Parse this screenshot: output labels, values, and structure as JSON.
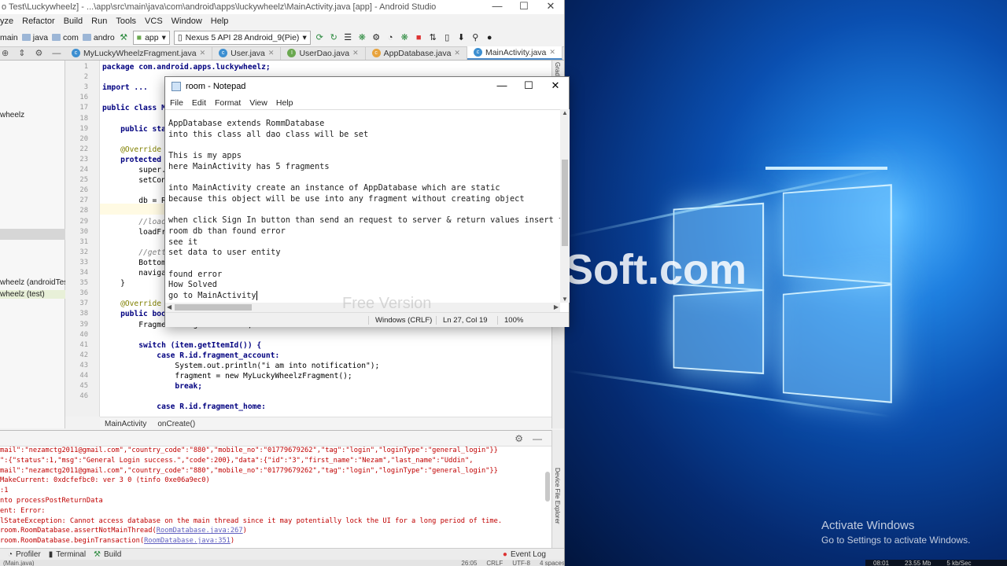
{
  "android_studio": {
    "title": "o Test\\Luckywheelz] - ...\\app\\src\\main\\java\\com\\android\\apps\\luckywheelz\\MainActivity.java [app] - Android Studio",
    "menu": [
      "yze",
      "Refactor",
      "Build",
      "Run",
      "Tools",
      "VCS",
      "Window",
      "Help"
    ],
    "breadcrumbs": [
      "main",
      "java",
      "com",
      "andro"
    ],
    "run_config": "app",
    "device": "Nexus 5 API 28 Android_9(Pie)",
    "tabs": [
      {
        "label": "MyLuckyWheelzFragment.java",
        "icon": "class-icon"
      },
      {
        "label": "User.java",
        "icon": "class-icon"
      },
      {
        "label": "UserDao.java",
        "icon": "interface-icon"
      },
      {
        "label": "AppDatabase.java",
        "icon": "abstract-class-icon"
      },
      {
        "label": "MainActivity.java",
        "icon": "class-icon",
        "active": true
      }
    ],
    "project_items": [
      "wheelz",
      "wheelz (androidTest)",
      "wheelz (test)"
    ],
    "line_numbers": [
      "1",
      "2",
      "3",
      "16",
      "17",
      "18",
      "19",
      "20",
      "22",
      "23",
      "24",
      "25",
      "26",
      "27",
      "28",
      "29",
      "30",
      "31",
      "32",
      "33",
      "34",
      "35",
      "36",
      "37",
      "38",
      "39",
      "40",
      "41",
      "42",
      "43",
      "44",
      "45",
      "46"
    ],
    "code_lines": [
      "package com.android.apps.luckywheelz;",
      "",
      "import ...",
      "",
      "public class Ma",
      "",
      "    public stat",
      "",
      "    @Override",
      "    protected v",
      "        super.o",
      "        setCont",
      "",
      "        db = Ro",
      "",
      "        //loadi",
      "        loadFra",
      "",
      "        //getti",
      "        BottomN",
      "        navigat",
      "    }",
      "",
      "    @Override",
      "    public bool",
      "        Fragment fragment = null;",
      "",
      "        switch (item.getItemId()) {",
      "            case R.id.fragment_account:",
      "                System.out.println(\"i am into notification\");",
      "                fragment = new MyLuckyWheelzFragment();",
      "                break;",
      "",
      "            case R.id.fragment_home:"
    ],
    "editor_breadcrumb": [
      "MainActivity",
      "onCreate()"
    ],
    "logcat_lines": [
      "mail\":\"nezamctg2011@gmail.com\",\"country_code\":\"880\",\"mobile_no\":\"01779679262\",\"tag\":\"login\",\"loginType\":\"general_login\"}}",
      "\":{\"status\":1,\"msg\":\"General Login success.\",\"code\":200},\"data\":{\"id\":\"3\",\"first_name\":\"Nezam\",\"last_name\":\"Uddin\",",
      "mail\":\"nezamctg2011@gmail.com\",\"country_code\":\"880\",\"mobile_no\":\"01779679262\",\"tag\":\"login\",\"loginType\":\"general_login\"}}",
      "MakeCurrent: 0xdcfefbc0: ver 3 0 (tinfo 0xe06a9ec0)",
      ":1",
      "nto processPostReturnData",
      "ent: Error:",
      "lStateException: Cannot access database on the main thread since it may potentially lock the UI for a long period of time.",
      "room.RoomDatabase.assertNotMainThread(",
      "room.RoomDatabase.beginTransaction("
    ],
    "logcat_links": [
      "RoomDatabase.java:267",
      "RoomDatabase.java:351"
    ],
    "bottom_tools": [
      "Profiler",
      "Terminal",
      "Build"
    ],
    "event_log": "Event Log",
    "status_bar": [
      "(Main.java)",
      "26:05",
      "CRLF",
      "UTF-8",
      "4 spaces"
    ],
    "right_tool_top": "Grad",
    "right_tool_bottom": "Device File Explorer"
  },
  "notepad": {
    "title": "room - Notepad",
    "menu": [
      "File",
      "Edit",
      "Format",
      "View",
      "Help"
    ],
    "lines": [
      "AppDatabase extends RommDatabase",
      "into this class all dao class will be set",
      "",
      "This is my apps",
      "here MainActivity has 5 fragments",
      "",
      "into MainActivity create an instance of AppDatabase which are static",
      "because this object will be use into any fragment without creating object",
      "",
      "when click Sign In button than send an request to server & return values insert to",
      "room db than found error",
      "see it",
      "set data to user entity",
      "",
      "found error",
      "How Solved",
      "go to MainActivity"
    ],
    "status": {
      "encoding": "Windows (CRLF)",
      "position": "Ln 27, Col 19",
      "zoom": "100%"
    }
  },
  "desktop": {
    "activate_title": "Activate Windows",
    "activate_sub": "Go to Settings to activate Windows.",
    "watermark": "Soft.com",
    "watermark_small": "Free Version",
    "taskbar": [
      "08:01",
      "23.55 Mb",
      "5 kb/Sec"
    ]
  },
  "colors": {
    "active_tab_underline": "#4a88c7",
    "log_error": "#c00000",
    "desktop_blue": "#1e7fe0"
  }
}
